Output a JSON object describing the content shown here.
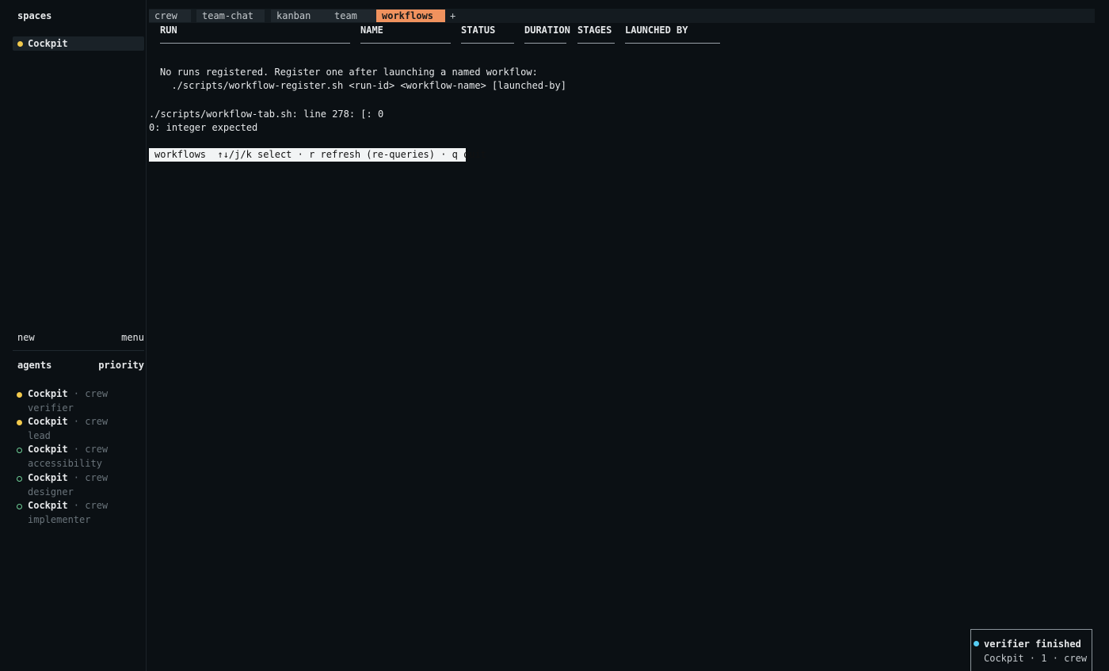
{
  "sidebar": {
    "spaces_heading": "spaces",
    "spaces": [
      {
        "label": "Cockpit"
      }
    ],
    "new_label": "new",
    "menu_label": "menu",
    "agents_heading": "agents",
    "priority_label": "priority",
    "agents": [
      {
        "name": "Cockpit",
        "meta": " · crew",
        "role": "verifier",
        "status": "active"
      },
      {
        "name": "Cockpit",
        "meta": " · crew",
        "role": "lead",
        "status": "active"
      },
      {
        "name": "Cockpit",
        "meta": " · crew",
        "role": "accessibility",
        "status": "idle"
      },
      {
        "name": "Cockpit",
        "meta": " · crew",
        "role": "designer",
        "status": "idle"
      },
      {
        "name": "Cockpit",
        "meta": " · crew",
        "role": "implementer",
        "status": "idle"
      }
    ]
  },
  "tabs": [
    {
      "label": "crew"
    },
    {
      "label": "team-chat"
    },
    {
      "label": "kanban"
    },
    {
      "label": "team"
    },
    {
      "label": "workflows",
      "active": true
    }
  ],
  "tab_add": "+",
  "table": {
    "columns": [
      "RUN",
      "NAME",
      "STATUS",
      "DURATION",
      "STAGES",
      "LAUNCHED BY"
    ]
  },
  "messages": {
    "empty_line1": "No runs registered. Register one after launching a named workflow:",
    "empty_line2": "  ./scripts/workflow-register.sh <run-id> <workflow-name> [launched-by]",
    "error_line1": "./scripts/workflow-tab.sh: line 278: [: 0",
    "error_line2": "0: integer expected"
  },
  "statusbar": "workflows  ↑↓/j/k select · r refresh (re-queries) · q quit",
  "toast": {
    "title": "verifier finished",
    "subtitle": "Cockpit · 1 · crew"
  },
  "colors": {
    "accent_tab": "#f0925e",
    "agent_active": "#f2c94c",
    "agent_idle": "#6fcf97",
    "toast_dot": "#56ccf2"
  }
}
